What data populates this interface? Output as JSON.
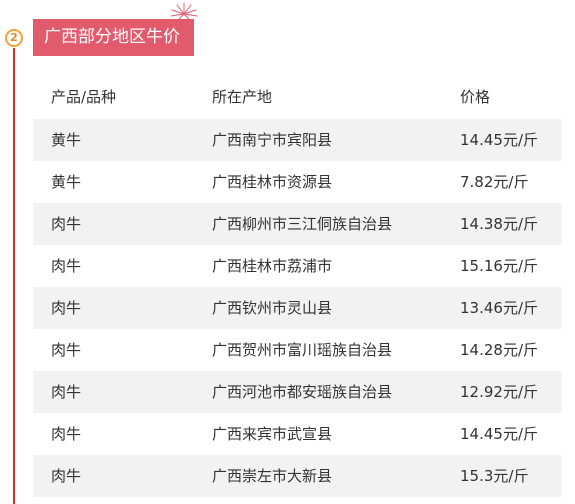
{
  "step_number": "2",
  "title": "广西部分地区牛价",
  "table": {
    "headers": [
      "产品/品种",
      "所在产地",
      "价格"
    ],
    "rows": [
      [
        "黄牛",
        "广西南宁市宾阳县",
        "14.45元/斤"
      ],
      [
        "黄牛",
        "广西桂林市资源县",
        "7.82元/斤"
      ],
      [
        "肉牛",
        "广西柳州市三江侗族自治县",
        "14.38元/斤"
      ],
      [
        "肉牛",
        "广西桂林市荔浦市",
        "15.16元/斤"
      ],
      [
        "肉牛",
        "广西钦州市灵山县",
        "13.46元/斤"
      ],
      [
        "肉牛",
        "广西贺州市富川瑶族自治县",
        "14.28元/斤"
      ],
      [
        "肉牛",
        "广西河池市都安瑶族自治县",
        "12.92元/斤"
      ],
      [
        "肉牛",
        "广西来宾市武宣县",
        "14.45元/斤"
      ],
      [
        "肉牛",
        "广西崇左市大新县",
        "15.3元/斤"
      ]
    ]
  },
  "colors": {
    "title_bg": "#e25b6c",
    "timeline": "#c9332e",
    "badge": "#f2a23c",
    "row_shade": "#f2f2f2"
  }
}
